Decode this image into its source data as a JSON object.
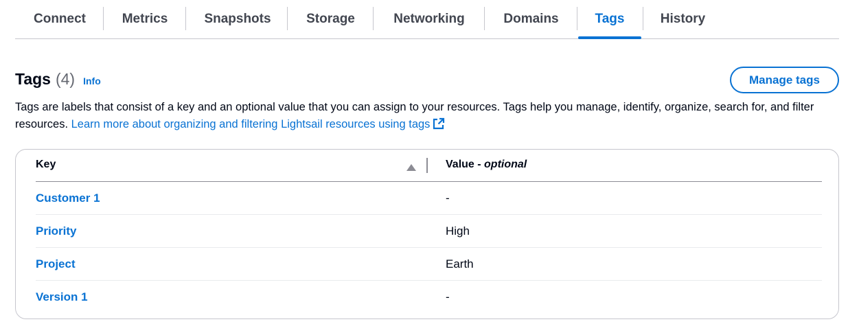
{
  "tabs": [
    {
      "label": "Connect",
      "active": false
    },
    {
      "label": "Metrics",
      "active": false
    },
    {
      "label": "Snapshots",
      "active": false
    },
    {
      "label": "Storage",
      "active": false
    },
    {
      "label": "Networking",
      "active": false
    },
    {
      "label": "Domains",
      "active": false
    },
    {
      "label": "Tags",
      "active": true
    },
    {
      "label": "History",
      "active": false
    }
  ],
  "header": {
    "title": "Tags",
    "count": "(4)",
    "info_link": "Info",
    "manage_button": "Manage tags"
  },
  "description": {
    "text": "Tags are labels that consist of a key and an optional value that you can assign to your resources. Tags help you manage, identify, organize, search for, and filter resources. ",
    "link_text": "Learn more about organizing and filtering Lightsail resources using tags",
    "link_icon": "external-link-icon"
  },
  "table": {
    "col_key": "Key",
    "col_value": "Value - ",
    "col_value_suffix": "optional",
    "sort_icon": "sort-ascending-icon",
    "rows": [
      {
        "key": "Customer 1",
        "value": "-"
      },
      {
        "key": "Priority",
        "value": "High"
      },
      {
        "key": "Project",
        "value": "Earth"
      },
      {
        "key": "Version 1",
        "value": "-"
      }
    ]
  },
  "colors": {
    "accent": "#0972d3",
    "text": "#000716",
    "tab_text": "#424650",
    "border": "#c6c6cd"
  }
}
